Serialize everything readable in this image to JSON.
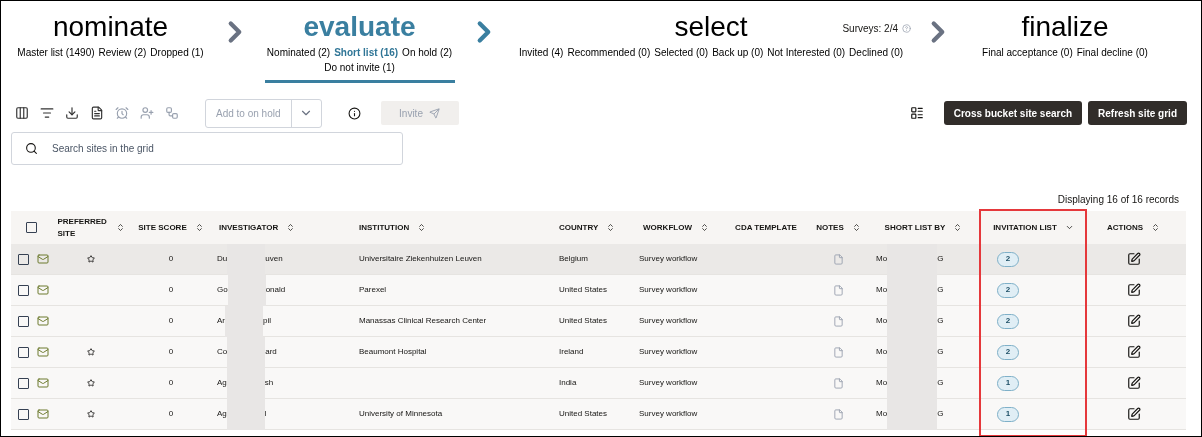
{
  "stages": [
    {
      "title": "nominate",
      "selected": false,
      "links": [
        {
          "label": "Master list (1490)",
          "selected": false
        },
        {
          "label": "Review (2)",
          "selected": false
        },
        {
          "label": "Dropped (1)",
          "selected": false
        }
      ]
    },
    {
      "title": "evaluate",
      "selected": true,
      "links": [
        {
          "label": "Nominated (2)",
          "selected": false
        },
        {
          "label": "Short list (16)",
          "selected": true
        },
        {
          "label": "On hold (2)",
          "selected": false
        },
        {
          "label": "Do not invite (1)",
          "selected": false
        }
      ]
    },
    {
      "title": "select",
      "selected": false,
      "surveys": "Surveys: 2/4",
      "links": [
        {
          "label": "Invited (4)",
          "selected": false
        },
        {
          "label": "Recommended (0)",
          "selected": false
        },
        {
          "label": "Selected (0)",
          "selected": false
        },
        {
          "label": "Back up (0)",
          "selected": false
        },
        {
          "label": "Not Interested (0)",
          "selected": false
        },
        {
          "label": "Declined (0)",
          "selected": false
        }
      ]
    },
    {
      "title": "finalize",
      "selected": false,
      "links": [
        {
          "label": "Final acceptance (0)",
          "selected": false
        },
        {
          "label": "Final decline (0)",
          "selected": false
        }
      ]
    }
  ],
  "toolbar": {
    "hold_action": "Add to on hold",
    "invite": "Invite",
    "invite_disabled": true,
    "buttons": [
      "Cross bucket site search",
      "Refresh site grid"
    ]
  },
  "search": {
    "placeholder": "Search sites in the grid"
  },
  "records": "Displaying 16 of 16 records",
  "table": {
    "select_all_checked": false,
    "columns": [
      "PREFERRED SITE",
      "SITE SCORE",
      "INVESTIGATOR",
      "INSTITUTION",
      "COUNTRY",
      "WORKFLOW",
      "CDA TEMPLATE",
      "NOTES",
      "SHORT LIST BY",
      "INVITATION LIST",
      "ACTIONS"
    ],
    "rows": [
      {
        "highlighted": true,
        "checked": false,
        "preferred": true,
        "score": "0",
        "investigator": [
          "Du",
          "uven"
        ],
        "institution": "Universitaire Ziekenhuizen Leuven",
        "country": "Belgium",
        "workflow": "Survey workflow",
        "short_list_by": [
          "Mo",
          "G"
        ],
        "invitations": "2"
      },
      {
        "highlighted": false,
        "checked": false,
        "preferred": false,
        "score": "0",
        "investigator": [
          "Go",
          "onald"
        ],
        "institution": "Parexel",
        "country": "United States",
        "workflow": "Survey workflow",
        "short_list_by": [
          "Mo",
          "G"
        ],
        "invitations": "2"
      },
      {
        "highlighted": false,
        "checked": false,
        "preferred": false,
        "score": "0",
        "investigator": [
          "Ar",
          "pil"
        ],
        "institution": "Manassas Clinical Research Center",
        "country": "United States",
        "workflow": "Survey workflow",
        "short_list_by": [
          "Mo",
          "G"
        ],
        "invitations": "2"
      },
      {
        "highlighted": false,
        "checked": false,
        "preferred": true,
        "score": "0",
        "investigator": [
          "Co",
          "ard"
        ],
        "institution": "Beaumont Hospital",
        "country": "Ireland",
        "workflow": "Survey workflow",
        "short_list_by": [
          "Mo",
          "G"
        ],
        "invitations": "2"
      },
      {
        "highlighted": false,
        "checked": false,
        "preferred": true,
        "score": "0",
        "investigator": [
          "Ag",
          "sh"
        ],
        "country": "India",
        "workflow": "Survey workflow",
        "short_list_by": [
          "Mo",
          "G"
        ],
        "invitations": "1"
      },
      {
        "highlighted": false,
        "checked": false,
        "preferred": true,
        "score": "0",
        "investigator": [
          "Ag",
          "l"
        ],
        "institution": "University of Minnesota",
        "country": "United States",
        "workflow": "Survey workflow",
        "short_list_by": [
          "Mo",
          "G"
        ],
        "invitations": "1"
      }
    ]
  }
}
